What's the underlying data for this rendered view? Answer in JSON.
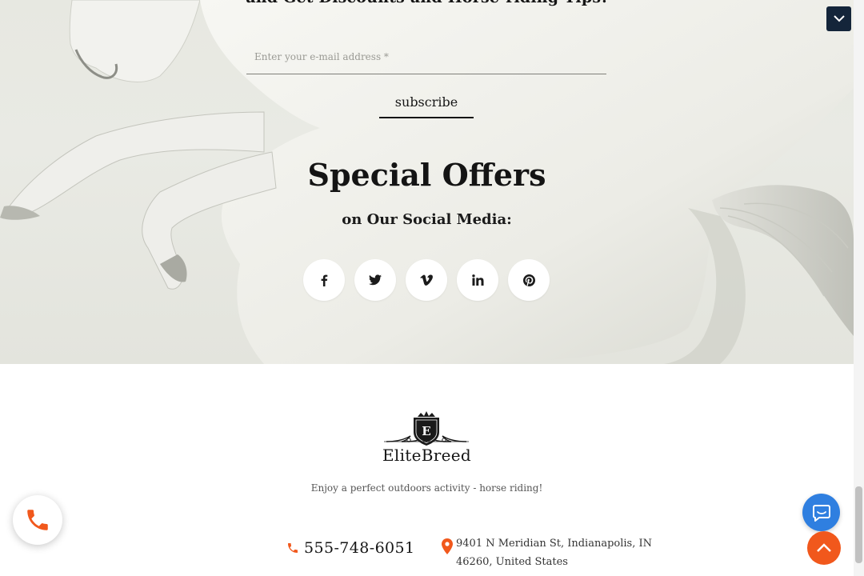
{
  "newsletter": {
    "heading_partial": "and Get Discounts and Horse-riding Tips!",
    "email_placeholder": "Enter your e-mail address *",
    "email_value": "",
    "subscribe_label": "subscribe"
  },
  "offers": {
    "title": "Special Offers",
    "subtitle": "on Our Social Media:"
  },
  "social": [
    {
      "name": "facebook-icon",
      "glyph": "f"
    },
    {
      "name": "twitter-icon",
      "glyph": "twitter"
    },
    {
      "name": "vimeo-icon",
      "glyph": "v"
    },
    {
      "name": "linkedin-icon",
      "glyph": "in"
    },
    {
      "name": "pinterest-icon",
      "glyph": "pinterest"
    }
  ],
  "footer": {
    "logo_letter": "E",
    "brand": "EliteBreed",
    "tagline": "Enjoy a perfect outdoors activity - horse riding!",
    "phone": "555-748-6051",
    "address_line1": "9401 N Meridian St, Indianapolis, IN",
    "address_line2": "46260, United States"
  },
  "colors": {
    "accent_orange": "#f1581c",
    "chat_blue": "#2f7fe0",
    "navy": "#14253a"
  }
}
